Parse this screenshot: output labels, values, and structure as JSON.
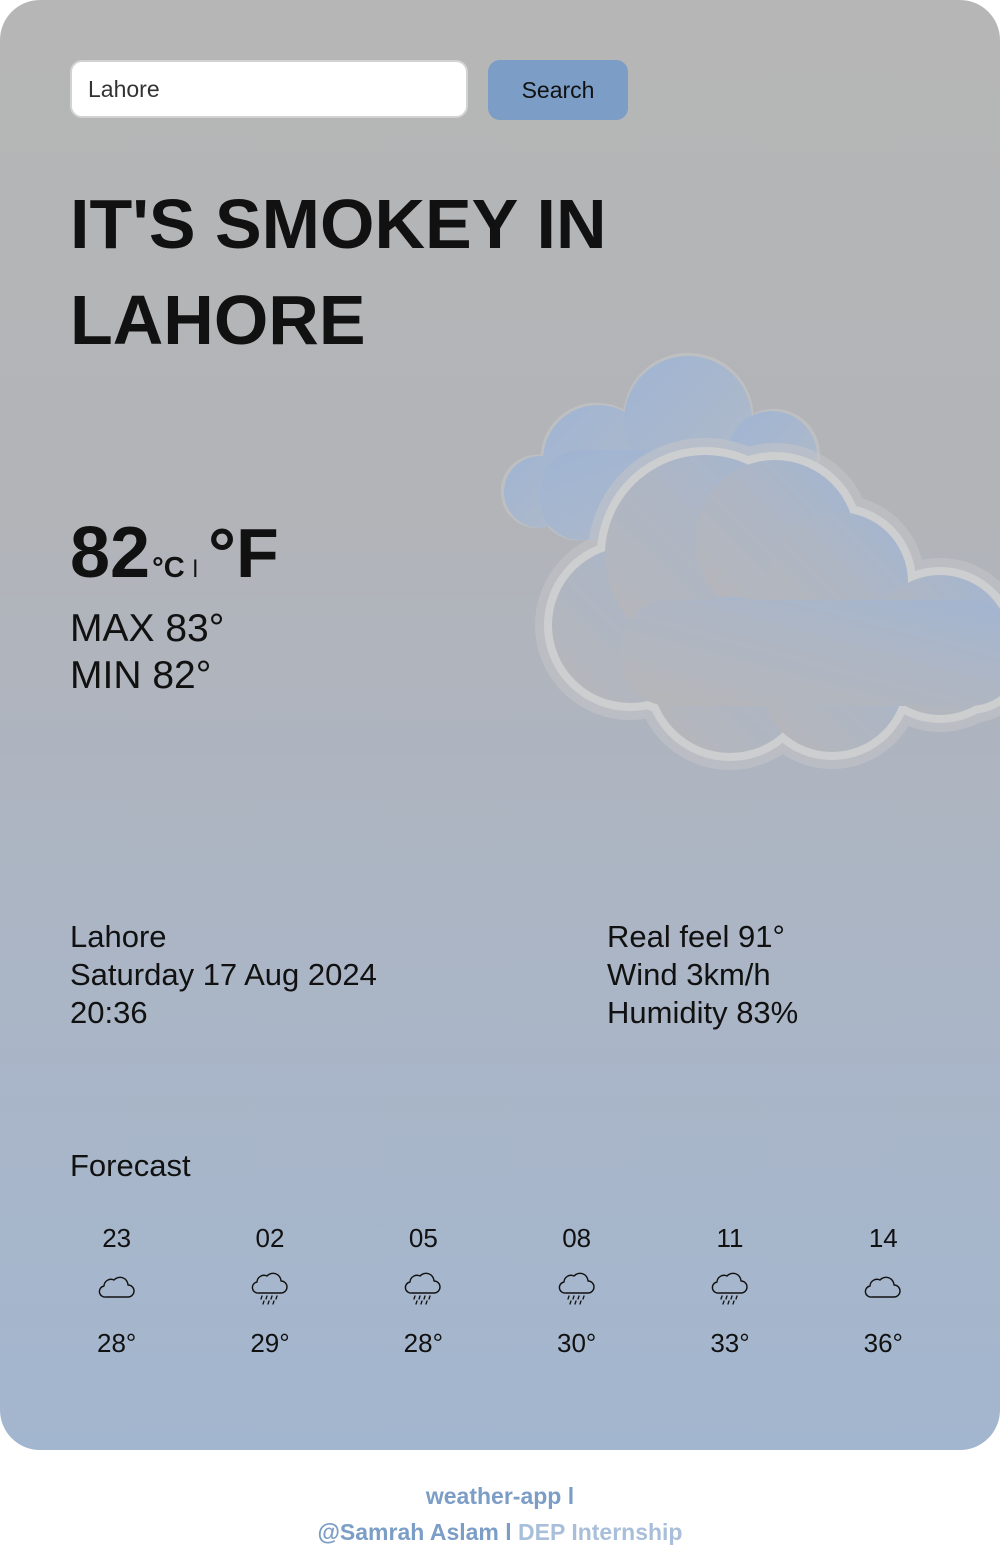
{
  "search": {
    "value": "Lahore",
    "button_label": "Search"
  },
  "headline": "IT'S SMOKEY IN LAHORE",
  "current": {
    "temp": "82",
    "unit_c": "°C",
    "unit_sep": "l",
    "unit_f": "°F",
    "max": "MAX 83°",
    "min": "MIN 82°"
  },
  "details": {
    "city": "Lahore",
    "date": "Saturday 17 Aug 2024",
    "time": "20:36",
    "real_feel": "Real feel 91°",
    "wind": "Wind 3km/h",
    "humidity": "Humidity 83%"
  },
  "forecast": {
    "title": "Forecast",
    "items": [
      {
        "hour": "23",
        "icon": "cloud-icon",
        "temp": "28°"
      },
      {
        "hour": "02",
        "icon": "rain-icon",
        "temp": "29°"
      },
      {
        "hour": "05",
        "icon": "rain-icon",
        "temp": "28°"
      },
      {
        "hour": "08",
        "icon": "rain-icon",
        "temp": "30°"
      },
      {
        "hour": "11",
        "icon": "rain-icon",
        "temp": "33°"
      },
      {
        "hour": "14",
        "icon": "cloud-icon",
        "temp": "36°"
      }
    ]
  },
  "footer": {
    "app": "weather-app l",
    "author": "@Samrah Aslam l",
    "program": "DEP Internship"
  },
  "colors": {
    "accent": "#7b9dc6",
    "accent_light": "#a9bfd9",
    "card_top": "#b6b6b6",
    "card_bottom": "#a3b6cf"
  }
}
